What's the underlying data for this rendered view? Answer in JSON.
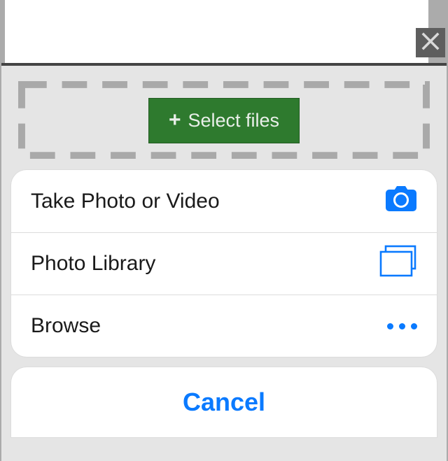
{
  "dropzone": {
    "select_label": "Select files"
  },
  "actionsheet": {
    "items": [
      {
        "label": "Take Photo or Video",
        "icon": "camera-icon"
      },
      {
        "label": "Photo Library",
        "icon": "photo-stack-icon"
      },
      {
        "label": "Browse",
        "icon": "more-dots-icon"
      }
    ],
    "cancel_label": "Cancel"
  },
  "colors": {
    "ios_blue": "#0a7aff",
    "select_green": "#2e7a2e"
  }
}
